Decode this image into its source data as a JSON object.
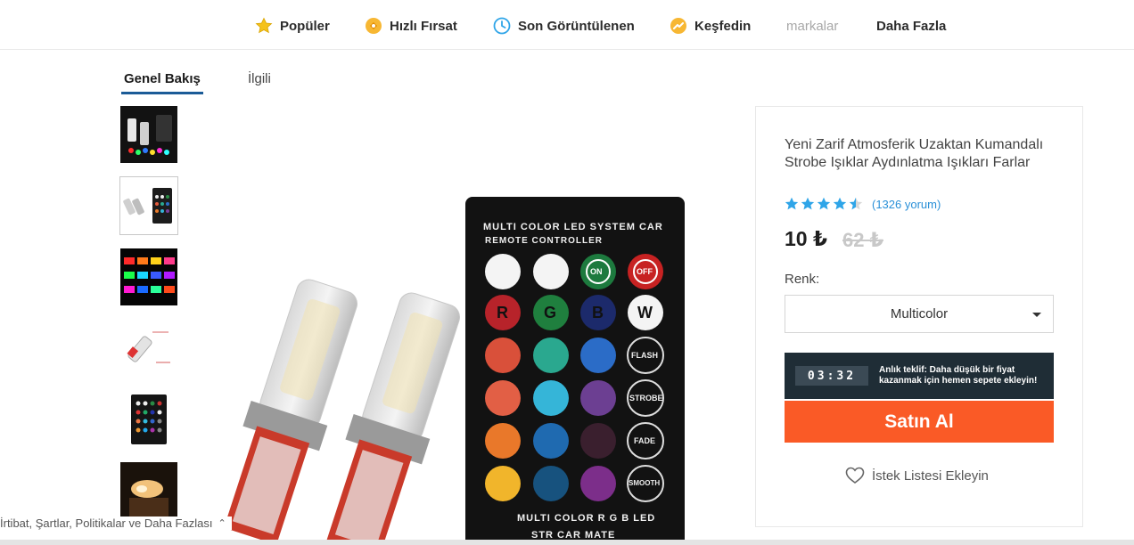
{
  "nav": {
    "items": [
      {
        "label": "Popüler",
        "icon": "star-icon"
      },
      {
        "label": "Hızlı Fırsat",
        "icon": "flash-deal-icon"
      },
      {
        "label": "Son Görüntülenen",
        "icon": "clock-icon"
      },
      {
        "label": "Keşfedin",
        "icon": "trend-icon"
      },
      {
        "label": "markalar",
        "icon": ""
      },
      {
        "label": "Daha Fazla",
        "icon": ""
      }
    ]
  },
  "tabs": {
    "overview": "Genel Bakış",
    "related": "İlgili"
  },
  "product": {
    "title": "Yeni Zarif Atmosferik Uzaktan Kumandalı Strobe Işıklar Aydınlatma Işıkları Farlar",
    "rating": 4.5,
    "reviews": "(1326 yorum)",
    "price": "10 ₺",
    "old_price": "62 ₺",
    "color_label": "Renk:",
    "color_selected": "Multicolor",
    "timer": "03:32",
    "offer_text": "Anlık teklif: Daha düşük bir fiyat kazanmak için hemen sepete ekleyin!",
    "buy_label": "Satın Al",
    "wishlist_label": "İstek Listesi Ekleyin"
  },
  "remote": {
    "line1": "MULTI COLOR LED SYSTEM CAR",
    "line2": "REMOTE CONTROLLER",
    "on": "ON",
    "off": "OFF",
    "r": "R",
    "g": "G",
    "b": "B",
    "w": "W",
    "flash": "FLASH",
    "strobe": "STROBE",
    "fade": "FADE",
    "smooth": "SMOOTH",
    "bottom1": "MULTI COLOR R G B LED",
    "bottom2": "STR CAR MATE"
  },
  "footer": {
    "link": "İrtibat, Şartlar, Politikalar ve Daha Fazlası"
  },
  "colors": {
    "accent_buy": "#fa5a26",
    "tab_underline": "#1b5b97",
    "star": "#2fa5e8",
    "offer_bg": "#1f2d36"
  }
}
